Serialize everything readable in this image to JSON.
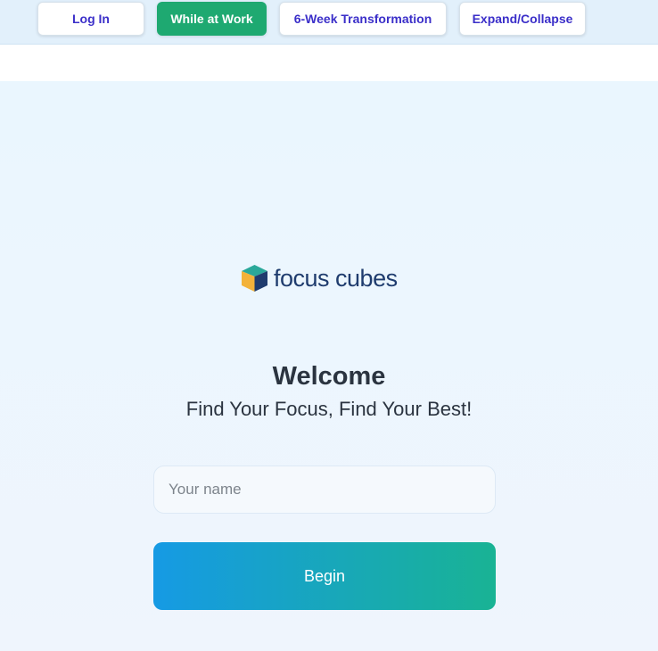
{
  "nav": {
    "buttons": [
      {
        "label": "Log In",
        "active": false
      },
      {
        "label": "While at Work",
        "active": true
      },
      {
        "label": "6-Week Transformation",
        "active": false
      },
      {
        "label": "Expand/Collapse",
        "active": false
      }
    ]
  },
  "brand": {
    "logo_text": "focus cubes",
    "logo_icon": "cube-icon"
  },
  "welcome": {
    "title": "Welcome",
    "subtitle": "Find Your Focus, Find Your Best!"
  },
  "form": {
    "name_placeholder": "Your name",
    "name_value": "",
    "begin_label": "Begin"
  },
  "colors": {
    "active_nav": "#1ea971",
    "nav_text": "#3b2fc9",
    "begin_gradient_start": "#169ae4",
    "begin_gradient_end": "#19b394",
    "logo_text": "#1f3c6e"
  }
}
